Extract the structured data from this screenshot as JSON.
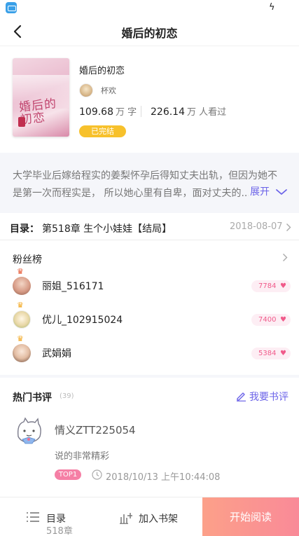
{
  "status_bar": {
    "app_icon": "app-icon",
    "bolt_icon": "charging-bolt-icon"
  },
  "nav": {
    "title": "婚后的初恋",
    "back_icon": "chevron-left-icon"
  },
  "book": {
    "cover_title": "婚后的初恋",
    "title": "婚后的初恋",
    "author": "杯欢",
    "word_count": "109.68",
    "word_unit": "万 字",
    "read_count": "226.14",
    "read_unit": "万 人看过",
    "status": "已完结"
  },
  "intro": {
    "text": "大学毕业后嫁给程实的姜梨怀孕后得知丈夫出轨，但因为她不是第一次而程实是， 所以她心里有自卑，面对丈夫的...",
    "more_label": "展开"
  },
  "toc": {
    "label": "目录：",
    "latest_chapter": "第518章 生个小娃娃【结局】",
    "date": "2018-08-07"
  },
  "fans": {
    "title": "粉丝榜",
    "items": [
      {
        "name": "丽姐_516171",
        "score": "7784"
      },
      {
        "name": "优儿_102915024",
        "score": "7400"
      },
      {
        "name": "武娟娟",
        "score": "5384"
      }
    ]
  },
  "reviews": {
    "title": "热门书评",
    "count": "(39)",
    "write_label": "我要书评",
    "items": [
      {
        "user": "情义ZTT225054",
        "text": "说的非常精彩",
        "badge": "TOP1",
        "time": "2018/10/13 上午10:44:08"
      }
    ]
  },
  "bottom_bar": {
    "toc_label": "目录",
    "toc_count": "518章",
    "shelf_label": "加入书架",
    "read_label": "开始阅读"
  },
  "colors": {
    "accent": "#6b63e8",
    "status_badge": "#f7c12c",
    "fan_score": "#f05a8a",
    "top_badge": "#f57fa5",
    "read_button": "#fa9590"
  }
}
